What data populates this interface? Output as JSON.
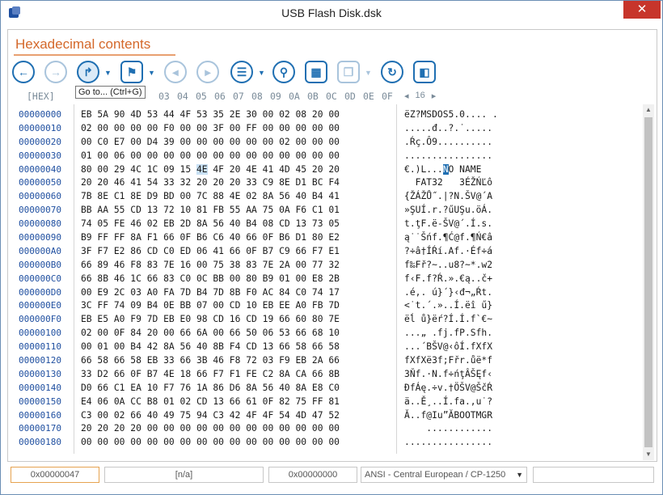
{
  "window": {
    "title": "USB Flash Disk.dsk",
    "close_glyph": "✕"
  },
  "section": {
    "title": "Hexadecimal contents"
  },
  "toolbar": {
    "buttons": [
      {
        "name": "back-button",
        "icon": "arrow-left-icon",
        "glyph": "←"
      },
      {
        "name": "forward-button",
        "icon": "arrow-right-icon",
        "glyph": "→"
      },
      {
        "name": "goto-button",
        "icon": "goto-icon",
        "glyph": "↱"
      },
      {
        "name": "bookmark-button",
        "icon": "bookmark-icon",
        "glyph": "⚑"
      },
      {
        "name": "prev-bookmark-button",
        "icon": "prev-bookmark-icon",
        "glyph": "◂"
      },
      {
        "name": "next-bookmark-button",
        "icon": "next-bookmark-icon",
        "glyph": "▸"
      },
      {
        "name": "list-button",
        "icon": "list-icon",
        "glyph": "☰"
      },
      {
        "name": "search-button",
        "icon": "search-icon",
        "glyph": "⚲"
      },
      {
        "name": "columns-button",
        "icon": "columns-icon",
        "glyph": "▦"
      },
      {
        "name": "copy-button",
        "icon": "copy-icon",
        "glyph": "❐"
      },
      {
        "name": "refresh-button",
        "icon": "refresh-icon",
        "glyph": "↻"
      },
      {
        "name": "panel-button",
        "icon": "panel-icon",
        "glyph": "◧"
      }
    ],
    "dropdown_glyph": "▼",
    "tooltip": "Go to... (Ctrl+G)"
  },
  "header": {
    "hex_label": "[HEX]",
    "columns": [
      "03",
      "04",
      "05",
      "06",
      "07",
      "08",
      "09",
      "0A",
      "0B",
      "0C",
      "0D",
      "0E",
      "0F"
    ],
    "page_prev": "◂",
    "page_number": "16",
    "page_next": "▸"
  },
  "rows": [
    {
      "offset": "00000000",
      "hex": "EB 5A 90 4D 53 44 4F 53 35 2E 30 00 02 08 20 00",
      "text": "ëZ?MSDOS5.0.... ."
    },
    {
      "offset": "00000010",
      "hex": "02 00 00 00 00 F0 00 00 3F 00 FF 00 00 00 00 00",
      "text": ".....đ..?.˙....."
    },
    {
      "offset": "00000020",
      "hex": "00 C0 E7 00 D4 39 00 00 00 00 00 00 02 00 00 00",
      "text": ".Ŕç.Ô9.........."
    },
    {
      "offset": "00000030",
      "hex": "01 00 06 00 00 00 00 00 00 00 00 00 00 00 00 00",
      "text": "................"
    },
    {
      "offset": "00000040",
      "hex": "80 00 29 4C 1C 09 15 4E 4F 20 4E 41 4D 45 20 20",
      "text": "€.)L...NO NAME  "
    },
    {
      "offset": "00000050",
      "hex": "20 20 46 41 54 33 32 20 20 20 33 C9 8E D1 BC F4",
      "text": "  FAT32   3ÉŽŃĽô"
    },
    {
      "offset": "00000060",
      "hex": "7B 8E C1 8E D9 BD 00 7C 88 4E 02 8A 56 40 B4 41",
      "text": "{ŽÁŽŮ˝.|?N.ŠV@´A"
    },
    {
      "offset": "00000070",
      "hex": "BB AA 55 CD 13 72 10 81 FB 55 AA 75 0A F6 C1 01",
      "text": "»ŞUÍ.r.?űUŞu.öÁ."
    },
    {
      "offset": "00000080",
      "hex": "74 05 FE 46 02 EB 2D 8A 56 40 B4 08 CD 13 73 05",
      "text": "t.ţF.ë-ŠV@´.Í.s."
    },
    {
      "offset": "00000090",
      "hex": "B9 FF FF 8A F1 66 0F B6 C6 40 66 0F B6 D1 80 E2",
      "text": "ą˙˙Šńf.¶Ć@f.¶Ń€â"
    },
    {
      "offset": "000000A0",
      "hex": "3F F7 E2 86 CD C0 ED 06 41 66 0F B7 C9 66 F7 E1",
      "text": "?÷â†ÍŔí.Af.·Éf÷á"
    },
    {
      "offset": "000000B0",
      "hex": "66 89 46 F8 83 7E 16 00 75 38 83 7E 2A 00 77 32",
      "text": "f‰Fř?~..u8?~*.w2"
    },
    {
      "offset": "000000C0",
      "hex": "66 8B 46 1C 66 83 C0 0C BB 00 80 B9 01 00 E8 2B",
      "text": "f‹F.f?Ŕ.».€ą..č+"
    },
    {
      "offset": "000000D0",
      "hex": "00 E9 2C 03 A0 FA 7D B4 7D 8B F0 AC 84 C0 74 17",
      "text": ".é,. ú}´}‹đ¬„Ŕt."
    },
    {
      "offset": "000000E0",
      "hex": "3C FF 74 09 B4 0E BB 07 00 CD 10 EB EE A0 FB 7D",
      "text": "<˙t.´.»..Í.ëî ű}"
    },
    {
      "offset": "000000F0",
      "hex": "EB E5 A0 F9 7D EB E0 98 CD 16 CD 19 66 60 80 7E",
      "text": "ëĺ ů}ëŕ?Í.Í.f`€~"
    },
    {
      "offset": "00000100",
      "hex": "02 00 0F 84 20 00 66 6A 00 66 50 06 53 66 68 10",
      "text": "...„ .fj.fP.Sfh."
    },
    {
      "offset": "00000110",
      "hex": "00 01 00 B4 42 8A 56 40 8B F4 CD 13 66 58 66 58",
      "text": "...´BŠV@‹ôÍ.fXfX"
    },
    {
      "offset": "00000120",
      "hex": "66 58 66 58 EB 33 66 3B 46 F8 72 03 F9 EB 2A 66",
      "text": "fXfXë3f;Fřr.ůë*f"
    },
    {
      "offset": "00000130",
      "hex": "33 D2 66 0F B7 4E 18 66 F7 F1 FE C2 8A CA 66 8B",
      "text": "3Ňf.·N.f÷ńţÂŠĘf‹"
    },
    {
      "offset": "00000140",
      "hex": "D0 66 C1 EA 10 F7 76 1A 86 D6 8A 56 40 8A E8 C0",
      "text": "ĐfÁę.÷v.†ÖŠV@ŠčŔ"
    },
    {
      "offset": "00000150",
      "hex": "E4 06 0A CC B8 01 02 CD 13 66 61 0F 82 75 FF 81",
      "text": "ä..Ě¸..Í.fa.‚u˙?"
    },
    {
      "offset": "00000160",
      "hex": "C3 00 02 66 40 49 75 94 C3 42 4F 4F 54 4D 47 52",
      "text": "Ă..f@Iu”ĂBOOTMGR"
    },
    {
      "offset": "00000170",
      "hex": "20 20 20 20 00 00 00 00 00 00 00 00 00 00 00 00",
      "text": "    ............"
    },
    {
      "offset": "00000180",
      "hex": "00 00 00 00 00 00 00 00 00 00 00 00 00 00 00 00",
      "text": "................"
    }
  ],
  "selection": {
    "row": 4,
    "byte_index": 7,
    "hex": "4E",
    "char": "N"
  },
  "status": {
    "position": "0x00000047",
    "value": "[n/a]",
    "offset": "0x00000000",
    "encoding": "ANSI - Central European / CP-1250",
    "encoding_arrow": "▼",
    "extra": ""
  },
  "scroll": {
    "up": "▲",
    "down": "▼"
  }
}
